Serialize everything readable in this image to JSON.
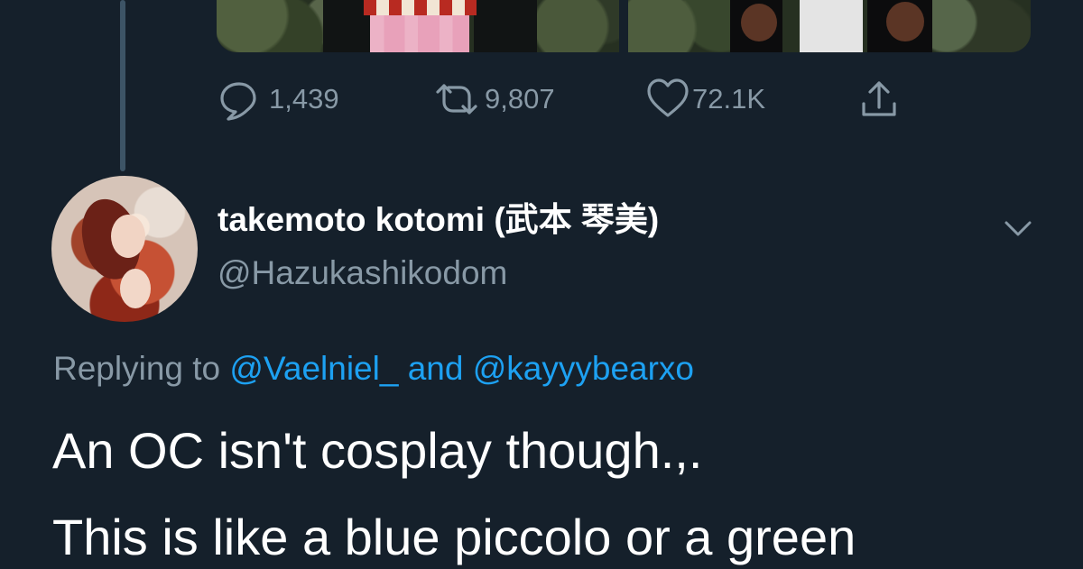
{
  "tweet": {
    "actions": {
      "reply_count": "1,439",
      "retweet_count": "9,807",
      "like_count": "72.1K"
    },
    "author": {
      "display_name": "takemoto kotomi (武本 琴美)",
      "handle": "@Hazukashikodom"
    },
    "replying": {
      "prefix": "Replying to",
      "mention_one": "@Vaelniel_",
      "connector": "and",
      "mention_two": "@kayyybearxo"
    },
    "body_lines": [
      "An OC isn't cosplay though.,.",
      "This is like a blue piccolo or a green"
    ]
  },
  "icons": {
    "reply": "reply-icon",
    "retweet": "retweet-icon",
    "like": "heart-icon",
    "share": "share-icon",
    "menu": "chevron-down-icon"
  },
  "colors": {
    "background": "#15202b",
    "primary_text": "#ffffff",
    "secondary_text": "#8899a6",
    "link": "#1da1f2",
    "thread_line": "#3d5466"
  }
}
